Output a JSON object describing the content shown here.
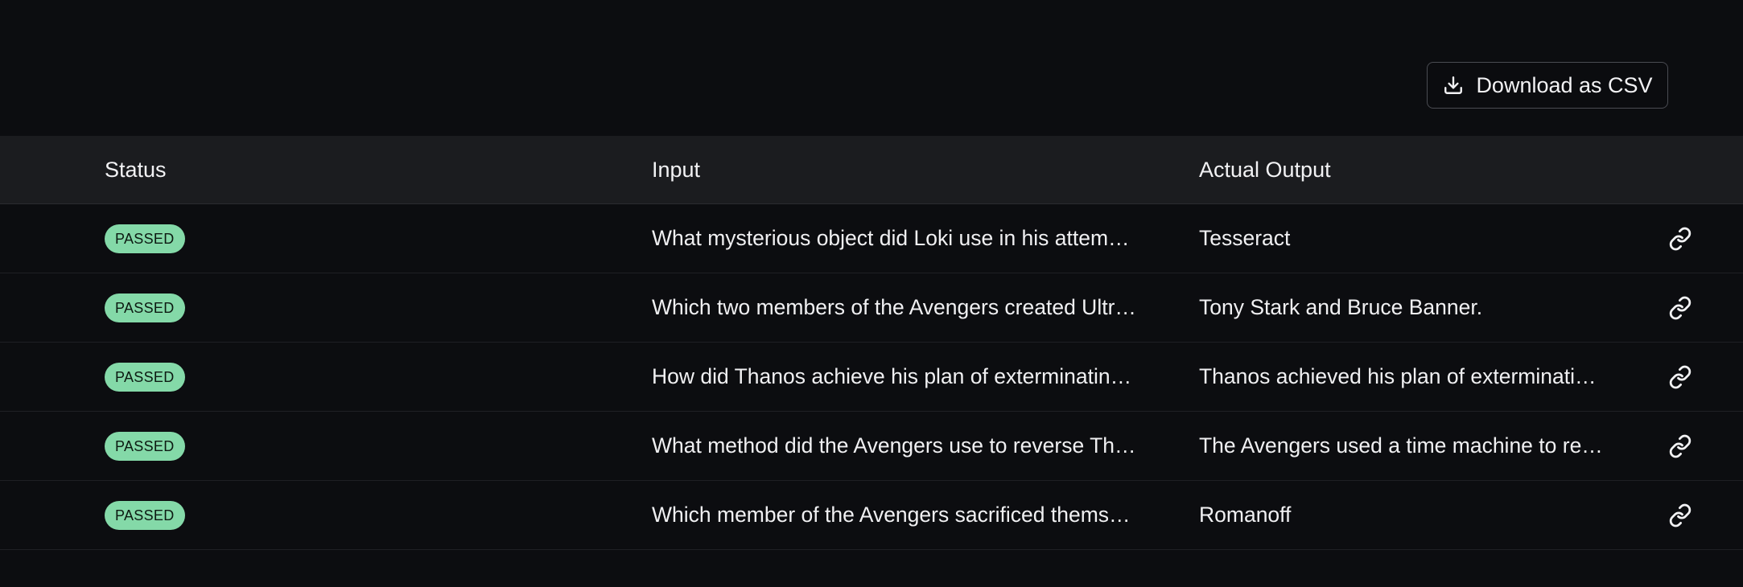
{
  "toolbar": {
    "download_label": "Download as CSV",
    "download_icon": "download-icon"
  },
  "table": {
    "columns": [
      "Status",
      "Input",
      "Actual Output"
    ],
    "rows": [
      {
        "status": "PASSED",
        "input": "What mysterious object did Loki use in his attem…",
        "output": "Tesseract",
        "link_icon": "link-icon"
      },
      {
        "status": "PASSED",
        "input": "Which two members of the Avengers created Ultr…",
        "output": "Tony Stark and Bruce Banner.",
        "link_icon": "link-icon"
      },
      {
        "status": "PASSED",
        "input": "How did Thanos achieve his plan of exterminatin…",
        "output": "Thanos achieved his plan of exterminati…",
        "link_icon": "link-icon"
      },
      {
        "status": "PASSED",
        "input": "What method did the Avengers use to reverse Th…",
        "output": "The Avengers used a time machine to re…",
        "link_icon": "link-icon"
      },
      {
        "status": "PASSED",
        "input": "Which member of the Avengers sacrificed thems…",
        "output": "Romanoff",
        "link_icon": "link-icon"
      }
    ]
  },
  "colors": {
    "background": "#0c0d10",
    "header_background": "#1b1c1f",
    "badge_passed": "#84d9a8",
    "text": "#f0f0f2"
  }
}
